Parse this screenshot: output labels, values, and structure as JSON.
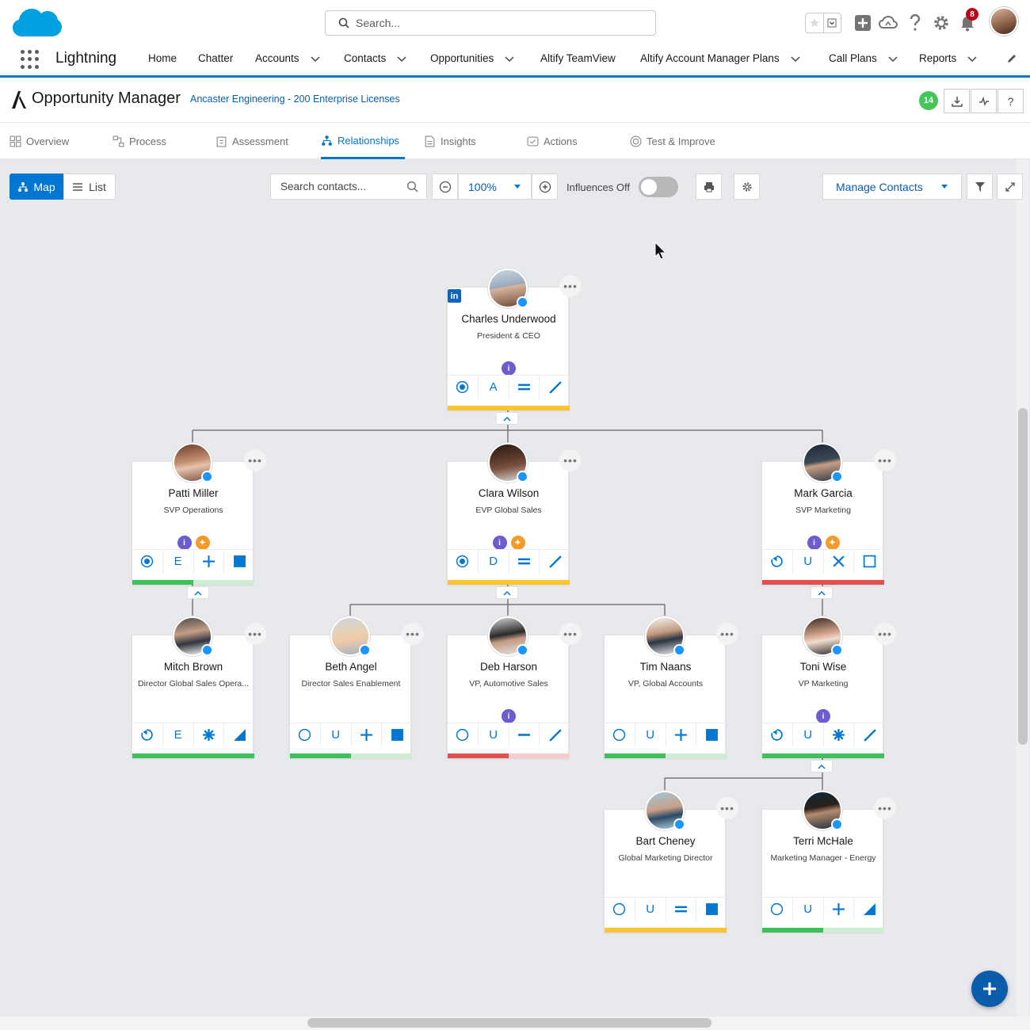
{
  "global_header": {
    "search_placeholder": "Search...",
    "notification_count": "8"
  },
  "nav": {
    "app_name": "Lightning",
    "items": [
      {
        "label": "Home",
        "dropdown": false
      },
      {
        "label": "Chatter",
        "dropdown": false
      },
      {
        "label": "Accounts",
        "dropdown": true
      },
      {
        "label": "Contacts",
        "dropdown": true
      },
      {
        "label": "Opportunities",
        "dropdown": true
      },
      {
        "label": "Altify TeamView",
        "dropdown": false
      },
      {
        "label": "Altify Account Manager Plans",
        "dropdown": true
      },
      {
        "label": "Call Plans",
        "dropdown": true
      },
      {
        "label": "Reports",
        "dropdown": true
      }
    ]
  },
  "app_header": {
    "title": "Opportunity Manager",
    "opportunity": "Ancaster Engineering - 200 Enterprise Licenses",
    "count_badge": "14"
  },
  "tabs": [
    {
      "label": "Overview",
      "icon": "grid-icon",
      "active": false
    },
    {
      "label": "Process",
      "icon": "process-icon",
      "active": false
    },
    {
      "label": "Assessment",
      "icon": "clipboard-icon",
      "active": false
    },
    {
      "label": "Relationships",
      "icon": "hierarchy-icon",
      "active": true
    },
    {
      "label": "Insights",
      "icon": "document-icon",
      "active": false
    },
    {
      "label": "Actions",
      "icon": "checklist-icon",
      "active": false
    },
    {
      "label": "Test & Improve",
      "icon": "target-icon",
      "active": false
    }
  ],
  "toolbar": {
    "map_label": "Map",
    "list_label": "List",
    "search_placeholder": "Search contacts...",
    "zoom": "100%",
    "influences_label": "Influences Off",
    "influences_on": false,
    "manage_contacts_label": "Manage Contacts"
  },
  "colors": {
    "accent": "#0176d3",
    "influence_purple": "#6b5ccf",
    "influence_orange": "#f59b2b",
    "status_yellow": "#fbc531",
    "status_green": "#3ec15a",
    "status_red": "#e24f4f"
  },
  "contacts": [
    {
      "id": "charles",
      "name": "Charles Underwood",
      "title": "President & CEO",
      "influence": [
        "purple"
      ],
      "icons": [
        "target",
        "A",
        "equals",
        "slash"
      ],
      "status": "yellow",
      "status_fill": 1.0,
      "linkedin": true
    },
    {
      "id": "patti",
      "name": "Patti Miller",
      "title": "SVP Operations",
      "influence": [
        "purple",
        "orange"
      ],
      "icons": [
        "target",
        "E",
        "plus",
        "square"
      ],
      "status": "green",
      "status_fill": 0.5
    },
    {
      "id": "clara",
      "name": "Clara Wilson",
      "title": "EVP Global Sales",
      "influence": [
        "purple",
        "orange"
      ],
      "icons": [
        "target",
        "D",
        "equals",
        "slash"
      ],
      "status": "yellow",
      "status_fill": 1.0
    },
    {
      "id": "mark",
      "name": "Mark Garcia",
      "title": "SVP Marketing",
      "influence": [
        "purple",
        "orange"
      ],
      "icons": [
        "refresh",
        "U",
        "x",
        "square-outline"
      ],
      "status": "red",
      "status_fill": 1.0
    },
    {
      "id": "mitch",
      "name": "Mitch Brown",
      "title": "Director Global Sales Opera...",
      "influence": [],
      "icons": [
        "refresh",
        "E",
        "star",
        "triangle"
      ],
      "status": "green",
      "status_fill": 1.0
    },
    {
      "id": "beth",
      "name": "Beth Angel",
      "title": "Director Sales Enablement",
      "influence": [],
      "icons": [
        "circle",
        "U",
        "plus",
        "square"
      ],
      "status": "green",
      "status_fill": 0.5
    },
    {
      "id": "deb",
      "name": "Deb Harson",
      "title": "VP, Automotive Sales",
      "influence": [
        "purple"
      ],
      "icons": [
        "circle",
        "U",
        "minus",
        "slash"
      ],
      "status": "red",
      "status_fill": 0.5
    },
    {
      "id": "tim",
      "name": "Tim Naans",
      "title": "VP, Global Accounts",
      "influence": [],
      "icons": [
        "circle",
        "U",
        "plus",
        "square"
      ],
      "status": "green",
      "status_fill": 0.5
    },
    {
      "id": "toni",
      "name": "Toni Wise",
      "title": "VP Marketing",
      "influence": [
        "purple"
      ],
      "icons": [
        "refresh",
        "U",
        "star",
        "slash"
      ],
      "status": "green",
      "status_fill": 1.0
    },
    {
      "id": "bart",
      "name": "Bart Cheney",
      "title": "Global Marketing Director",
      "influence": [],
      "icons": [
        "circle",
        "U",
        "equals",
        "square"
      ],
      "status": "yellow",
      "status_fill": 1.0
    },
    {
      "id": "terri",
      "name": "Terri McHale",
      "title": "Marketing Manager - Energy",
      "influence": [],
      "icons": [
        "circle",
        "U",
        "plus",
        "triangle"
      ],
      "status": "green",
      "status_fill": 0.5
    }
  ]
}
